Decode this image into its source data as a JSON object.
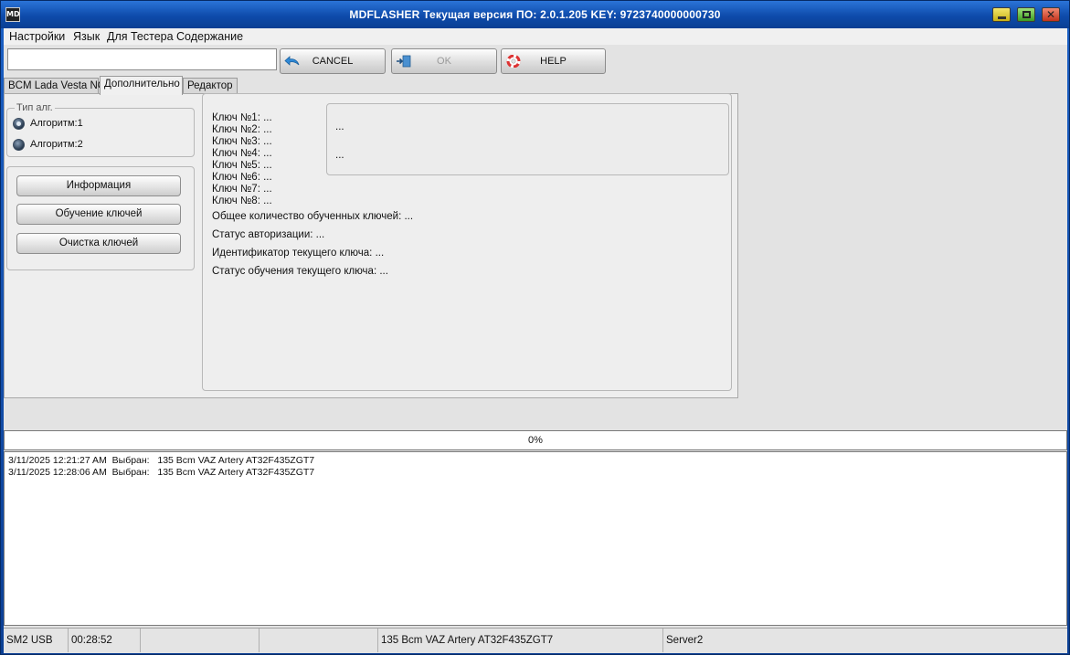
{
  "window": {
    "title": "MDFLASHER  Текущая версия ПО: 2.0.1.205  KEY: 9723740000000730",
    "app_icon": "MD"
  },
  "menu": {
    "items": [
      "Настройки",
      "Язык",
      "Для Тестера",
      "Содержание"
    ]
  },
  "toolbar": {
    "input_value": "",
    "cancel_label": "CANCEL",
    "ok_label": "OK",
    "help_label": "HELP",
    "icons": {
      "cancel": "back-arrow-icon",
      "ok": "door-exit-icon",
      "help": "lifebuoy-icon"
    }
  },
  "tabs": [
    {
      "label": "BCM Lada Vesta NG",
      "active": false
    },
    {
      "label": "Дополнительно",
      "active": true
    },
    {
      "label": "Редактор",
      "active": false
    }
  ],
  "algorithm": {
    "legend": "Тип алг.",
    "options": [
      {
        "label": "Алгоритм:1",
        "checked": true
      },
      {
        "label": "Алгоритм:2",
        "checked": false
      }
    ]
  },
  "actions": {
    "info_label": "Информация",
    "learn_label": "Обучение ключей",
    "clear_label": "Очистка ключей"
  },
  "keys": {
    "lines": [
      "Ключ №1: ...",
      "Ключ №2: ...",
      "Ключ №3: ...",
      "Ключ №4: ...",
      "Ключ №5: ...",
      "Ключ №6: ...",
      "Ключ №7: ...",
      "Ключ №8: ..."
    ],
    "total_learned": "Общее количество обученных ключей: ...",
    "auth_status": "Статус авторизации: ...",
    "current_key_id": "Идентификатор текущего ключа: ...",
    "current_key_learn_status": "Статус обучения текущего ключа: ...",
    "info_box_line1": "...",
    "info_box_line2": "..."
  },
  "progress": {
    "text": "0%",
    "value": 0
  },
  "log": {
    "lines": [
      "3/11/2025 12:21:27 AM  Выбран:   135 Bcm VAZ Artery AT32F435ZGT7",
      "3/11/2025 12:28:06 AM  Выбран:   135 Bcm VAZ Artery AT32F435ZGT7"
    ]
  },
  "statusbar": {
    "port": "SM2 USB",
    "timer": "00:28:52",
    "cell3": "",
    "cell4": "",
    "device": "135 Bcm VAZ Artery AT32F435ZGT7",
    "server": "Server2"
  }
}
